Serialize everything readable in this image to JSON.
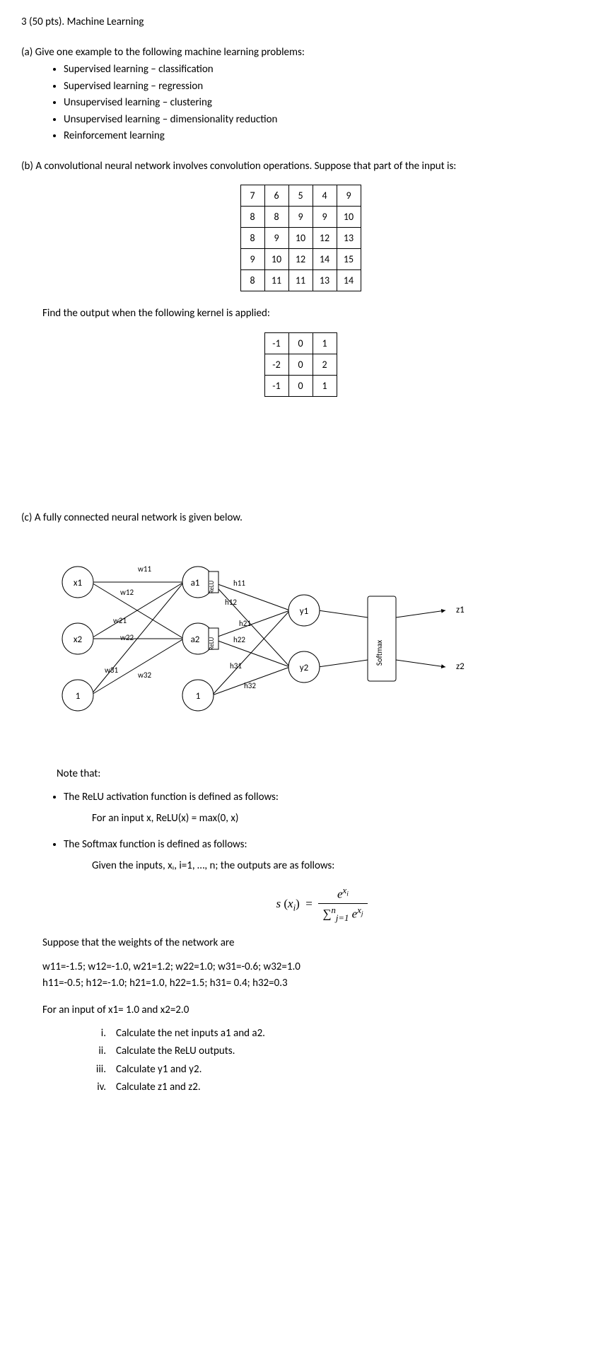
{
  "title": "3 (50 pts). Machine Learning",
  "part_a": {
    "prompt": "(a)  Give one example to the following machine learning problems:",
    "items": [
      "Supervised learning – classification",
      "Supervised learning – regression",
      "Unsupervised learning – clustering",
      "Unsupervised learning – dimensionality reduction",
      "Reinforcement learning"
    ]
  },
  "part_b": {
    "prompt": "(b)  A convolutional neural network involves convolution operations. Suppose that part of the input is:",
    "input_matrix": [
      [
        "7",
        "6",
        "5",
        "4",
        "9"
      ],
      [
        "8",
        "8",
        "9",
        "9",
        "10"
      ],
      [
        "8",
        "9",
        "10",
        "12",
        "13"
      ],
      [
        "9",
        "10",
        "12",
        "14",
        "15"
      ],
      [
        "8",
        "11",
        "11",
        "13",
        "14"
      ]
    ],
    "mid": "Find the output when the following kernel is applied:",
    "kernel": [
      [
        "-1",
        "0",
        "1"
      ],
      [
        "-2",
        "0",
        "2"
      ],
      [
        "-1",
        "0",
        "1"
      ]
    ]
  },
  "part_c": {
    "prompt": "(c)  A fully connected neural network is given below.",
    "nn": {
      "x1": "x1",
      "x2": "x2",
      "one": "1",
      "a1": "a1",
      "a2": "a2",
      "relu": "ReLU",
      "softmax": "Softmax",
      "y1": "y1",
      "y2": "y2",
      "z1": "z1",
      "z2": "z2",
      "w11": "w11",
      "w12": "w12",
      "w21": "w21",
      "w22": "w22",
      "w31": "w31",
      "w32": "w32",
      "h11": "h11",
      "h12": "h12",
      "h21": "h21",
      "h22": "h22",
      "h31": "h31",
      "h32": "h32"
    },
    "note_label": "Note that:",
    "notes": [
      "The ReLU activation function is defined as follows:",
      "The Softmax function is defined as follows:"
    ],
    "relu_def": "For an input x, ReLU(x) = max(0, x)",
    "softmax_def": "Given the inputs, xᵢ, i=1, …, n; the outputs are as follows:",
    "suppose": "Suppose that the weights of the network are",
    "weights1": "w11=-1.5; w12=-1.0, w21=1.2; w22=1.0; w31=-0.6; w32=1.0",
    "weights2": "h11=-0.5; h12=-1.0; h21=1.0, h22=1.5; h31= 0.4; h32=0.3",
    "for_input": "For an input of x1= 1.0 and x2=2.0",
    "tasks": [
      {
        "rn": "i.",
        "txt": "Calculate the net inputs a1 and a2."
      },
      {
        "rn": "ii.",
        "txt": "Calculate the ReLU outputs."
      },
      {
        "rn": "iii.",
        "txt": "Calculate y1 and y2."
      },
      {
        "rn": "iv.",
        "txt": "Calculate z1 and z2."
      }
    ]
  }
}
